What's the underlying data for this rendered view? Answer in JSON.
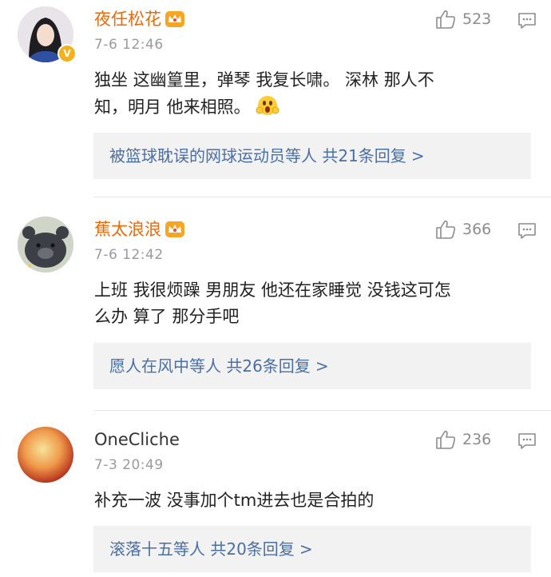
{
  "comments": [
    {
      "username": "夜任松花",
      "timestamp": "7-6 12:46",
      "likes": "523",
      "text_line1": "独坐 这幽篁里，弹琴 我复长啸。 深林 那人不",
      "text_line2": "知，明月 他来相照。",
      "replies_prefix": "被篮球耽误的网球运动员等人",
      "replies_count": "共21条回复",
      "replies_arrow": ">"
    },
    {
      "username": "蕉太浪浪",
      "timestamp": "7-6 12:42",
      "likes": "366",
      "text_line1": "上班 我很烦躁  男朋友 他还在家睡觉  没钱这可怎",
      "text_line2": "么办 算了 那分手吧",
      "replies_prefix": "愿人在风中等人",
      "replies_count": "共26条回复",
      "replies_arrow": ">"
    },
    {
      "username": "OneCliche",
      "timestamp": "7-3 20:49",
      "likes": "236",
      "text_line1": "补充一波 没事加个tm进去也是合拍的",
      "replies_prefix": "滚落十五等人",
      "replies_count": "共20条回复",
      "replies_arrow": ">"
    }
  ],
  "colors": {
    "vip_name": "#e86b0c",
    "link": "#4a6fa5",
    "muted": "#9a9a9a",
    "reply_bg": "#f2f2f2"
  },
  "icons": {
    "like": "thumbs-up-icon",
    "reply": "comment-bubble-icon",
    "vip": "crown-icon",
    "verified": "verified-v-icon",
    "emoji": "surprised-face-emoji"
  }
}
